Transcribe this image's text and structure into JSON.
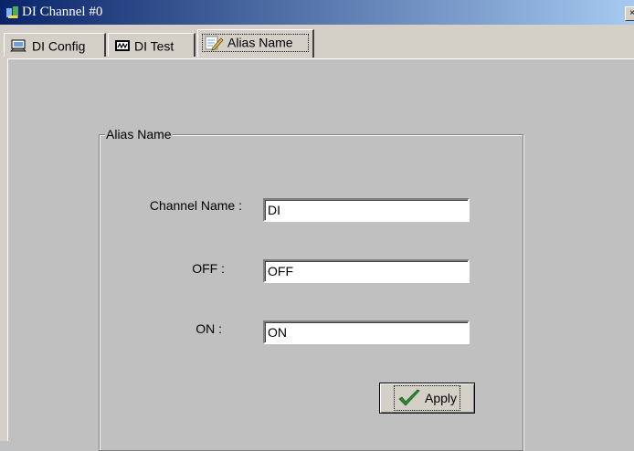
{
  "window": {
    "title": "DI Channel #0",
    "close_glyph": "×"
  },
  "tabs": [
    {
      "label": "DI Config",
      "icon": "monitor-config-icon"
    },
    {
      "label": "DI Test",
      "icon": "chip-icon"
    },
    {
      "label": "Alias Name",
      "icon": "pencil-notepad-icon",
      "active": true
    }
  ],
  "alias_group": {
    "title": "Alias Name",
    "channel_name": {
      "label": "Channel Name :",
      "value": "DI"
    },
    "off": {
      "label": "OFF :",
      "value": "OFF"
    },
    "on": {
      "label": "ON :",
      "value": "ON"
    },
    "apply_label": "Apply"
  },
  "colors": {
    "titlebar_start": "#0a246a",
    "titlebar_end": "#a6caf0",
    "check": "#2e8b2e"
  }
}
